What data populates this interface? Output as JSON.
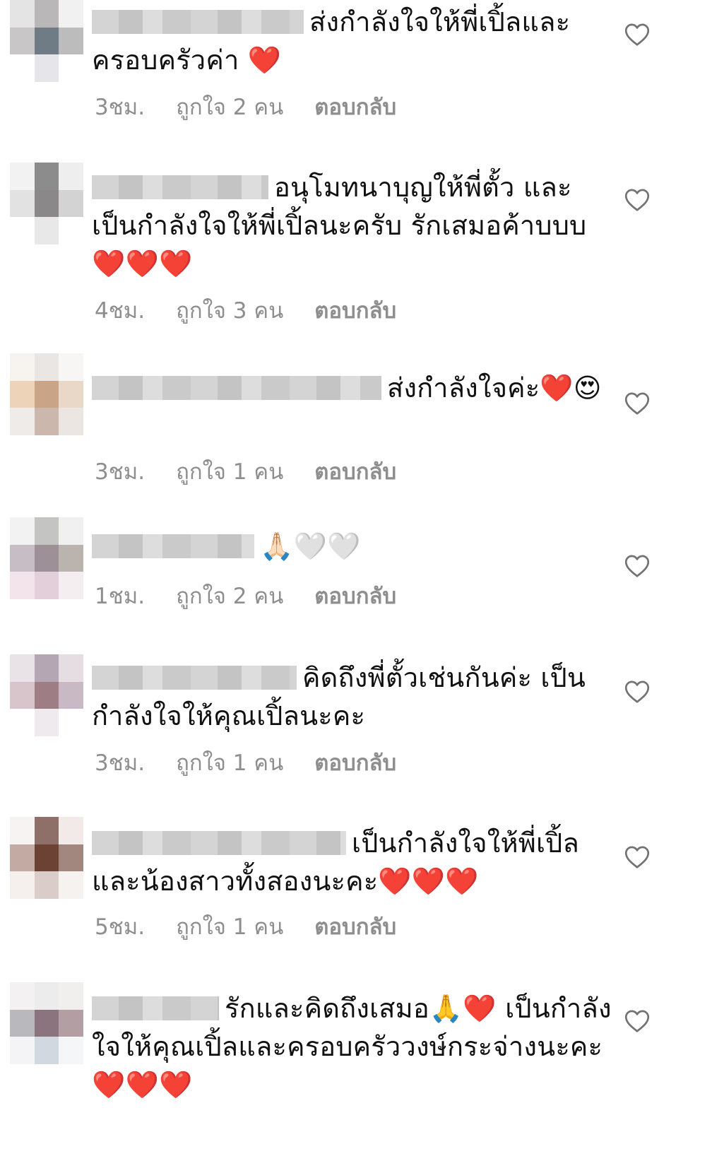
{
  "comments": [
    {
      "text": "ส่งกำลังใจให้พี่เปิ้ลและครอบครัวค่า ❤️",
      "time": "3ชม.",
      "likes": "ถูกใจ 2 คน",
      "reply": "ตอบกลับ",
      "avatar_colors": [
        "#e4e4e4",
        "#b9b7b8",
        "#f1f1f1",
        "#c8c6c7",
        "#6f7b85",
        "#bcbcbc",
        "#ffffff",
        "#e6e6ea",
        "#ffffff"
      ]
    },
    {
      "text": "อนุโมทนาบุญให้พี่ตั้ว และเป็นกำลังใจให้พี่เปิ้ลนะครับ รักเสมอค้าบบบ ❤️❤️❤️",
      "time": "4ชม.",
      "likes": "ถูกใจ 3 คน",
      "reply": "ตอบกลับ",
      "avatar_colors": [
        "#f2f2f2",
        "#8d8c8c",
        "#eeeeee",
        "#e2e2e2",
        "#8a8889",
        "#d3d3d3",
        "#ffffff",
        "#e8e8e8",
        "#ffffff"
      ]
    },
    {
      "text": "ส่งกำลังใจค่ะ❤️😍",
      "time": "3ชม.",
      "likes": "ถูกใจ 1 คน",
      "reply": "ตอบกลับ",
      "avatar_colors": [
        "#f7f3ef",
        "#e9e6e3",
        "#f7f6f4",
        "#edd3b7",
        "#c9a487",
        "#e9d8c7",
        "#efebe8",
        "#ccb7ac",
        "#ece6e2"
      ]
    },
    {
      "text": "🙏🏻🤍🤍",
      "time": "1ชม.",
      "likes": "ถูกใจ 2 คน",
      "reply": "ตอบกลับ",
      "avatar_colors": [
        "#f2f2f2",
        "#c4c4c2",
        "#f0f0f0",
        "#c6bec4",
        "#9d9097",
        "#bab3ae",
        "#f3e4ec",
        "#e3cfd9",
        "#f4eef1"
      ]
    },
    {
      "text": "คิดถึงพี่ตั้วเช่นกันค่ะ เป็นกำลังใจให้คุณเปิ้ลนะคะ",
      "time": "3ชม.",
      "likes": "ถูกใจ 1 คน",
      "reply": "ตอบกลับ",
      "avatar_colors": [
        "#e9e2e7",
        "#b5a6b3",
        "#e6dde2",
        "#d8c5cc",
        "#9e7d84",
        "#c9b9c4",
        "#ffffff",
        "#efeaed",
        "#ffffff"
      ]
    },
    {
      "text": "เป็นกำลังใจให้พี่เปิ้ลและน้องสาวทั้งสองนะคะ❤️❤️❤️",
      "time": "5ชม.",
      "likes": "ถูกใจ 1 คน",
      "reply": "ตอบกลับ",
      "avatar_colors": [
        "#f7f3f2",
        "#8f7068",
        "#f1eae8",
        "#c3aaa3",
        "#6b4234",
        "#a2877e",
        "#f5f0ee",
        "#dacdc9",
        "#f6f2f0"
      ]
    },
    {
      "text": "รักและคิดถึงเสมอ🙏❤️ เป็นกำลังใจให้คุณเปิ้ลและครอบครัววงษ์กระจ่างนะคะ❤️❤️❤️",
      "time": "",
      "likes": "",
      "reply": "",
      "avatar_colors": [
        "#f3f1f2",
        "#ececec",
        "#f1eeee",
        "#b9b8bc",
        "#8b747e",
        "#b39ea3",
        "#f4f4f6",
        "#d1d8df",
        "#f4f6f8"
      ]
    }
  ]
}
